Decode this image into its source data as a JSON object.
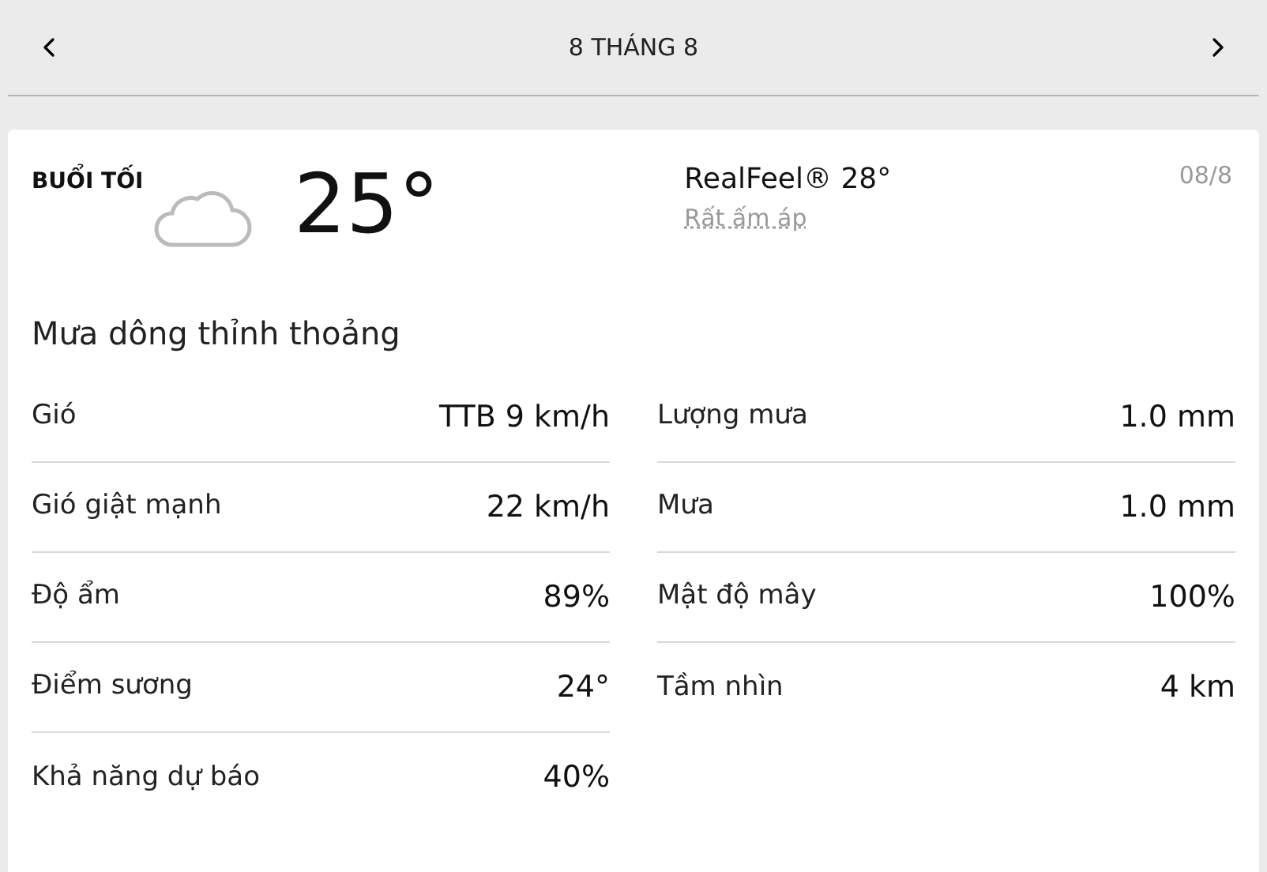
{
  "header": {
    "title": "8 THÁNG 8"
  },
  "card": {
    "period": "BUỔI TỐI",
    "temperature": "25°",
    "realfeel": "RealFeel® 28°",
    "realfeel_note": "Rất ấm áp",
    "date": "08/8",
    "condition": "Mưa dông thỉnh thoảng",
    "left_rows": [
      {
        "label": "Gió",
        "value": "TTB 9 km/h"
      },
      {
        "label": "Gió giật mạnh",
        "value": "22 km/h"
      },
      {
        "label": "Độ ẩm",
        "value": "89%"
      },
      {
        "label": "Điểm sương",
        "value": "24°"
      },
      {
        "label": "Khả năng dự báo",
        "value": "40%"
      }
    ],
    "right_rows": [
      {
        "label": "Lượng mưa",
        "value": "1.0 mm"
      },
      {
        "label": "Mưa",
        "value": "1.0 mm"
      },
      {
        "label": "Mật độ mây",
        "value": "100%"
      },
      {
        "label": "Tầm nhìn",
        "value": "4 km"
      }
    ]
  }
}
